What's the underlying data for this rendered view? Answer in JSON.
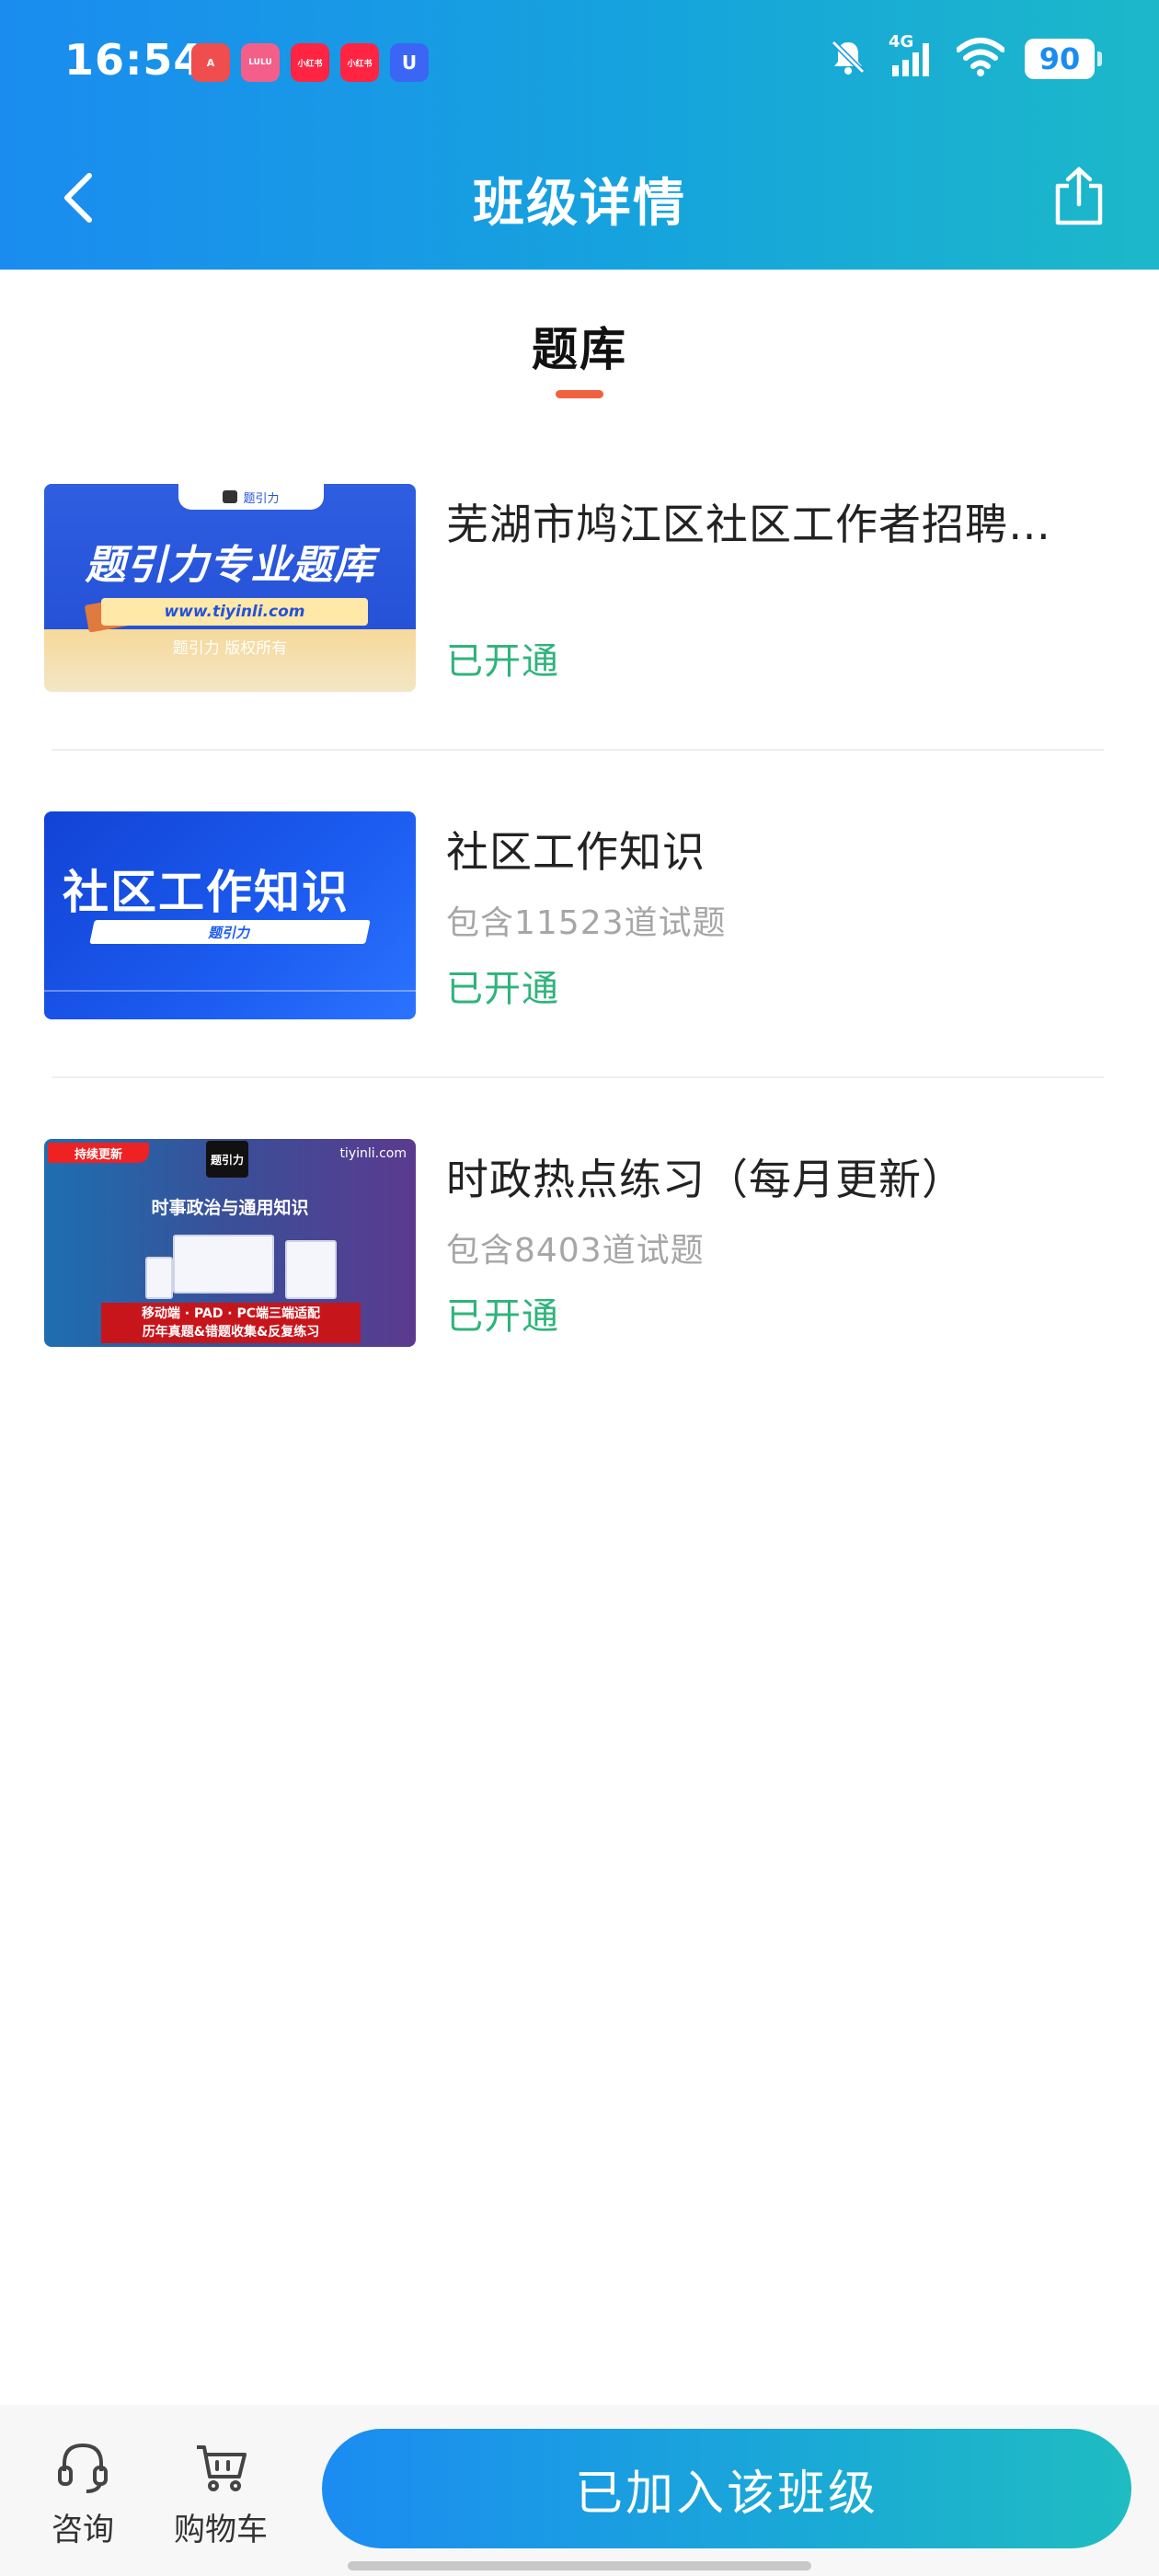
{
  "status_bar": {
    "time": "16:54",
    "battery": "90",
    "network": "4G",
    "notification_apps": [
      {
        "icon": "app-a-icon",
        "color": "#f04e4e",
        "label": "A"
      },
      {
        "icon": "lulu-app-icon",
        "color": "#f45f8a",
        "label": "LULU"
      },
      {
        "icon": "xiaohongshu-icon",
        "color": "#ff2442",
        "label": "小红书"
      },
      {
        "icon": "xiaohongshu-icon",
        "color": "#ff2442",
        "label": "小红书"
      },
      {
        "icon": "u-app-icon",
        "color": "#3b66f5",
        "label": "U"
      }
    ]
  },
  "nav": {
    "title": "班级详情"
  },
  "section": {
    "tab_label": "题库",
    "accent": "#f0623f"
  },
  "items": [
    {
      "title": "芜湖市鸠江区社区工作者招聘…",
      "count": "",
      "status": "已开通",
      "thumb": {
        "tab": "题引力",
        "heading": "题引力专业题库",
        "url": "www.tiyinli.com",
        "copyright": "题引力 版权所有"
      }
    },
    {
      "title": "社区工作知识",
      "count": "包含11523道试题",
      "status": "已开通",
      "thumb": {
        "heading": "社区工作知识",
        "bar": "题引力"
      }
    },
    {
      "title": "时政热点练习（每月更新）",
      "count": "包含8403道试题",
      "status": "已开通",
      "thumb": {
        "badge": "持续更新",
        "logo": "题引力",
        "site": "tiyinli.com",
        "subtitle": "时事政治与通用知识",
        "red_line1": "移动端 · PAD · PC端三端适配",
        "red_line2": "历年真题&错题收集&反复练习"
      }
    }
  ],
  "bottom_bar": {
    "consult_label": "咨询",
    "cart_label": "购物车",
    "join_button": "已加入该班级"
  },
  "colors": {
    "header_gradient_start": "#1a8cf0",
    "header_gradient_end": "#1cb8c9",
    "status_green": "#2fb47b"
  }
}
